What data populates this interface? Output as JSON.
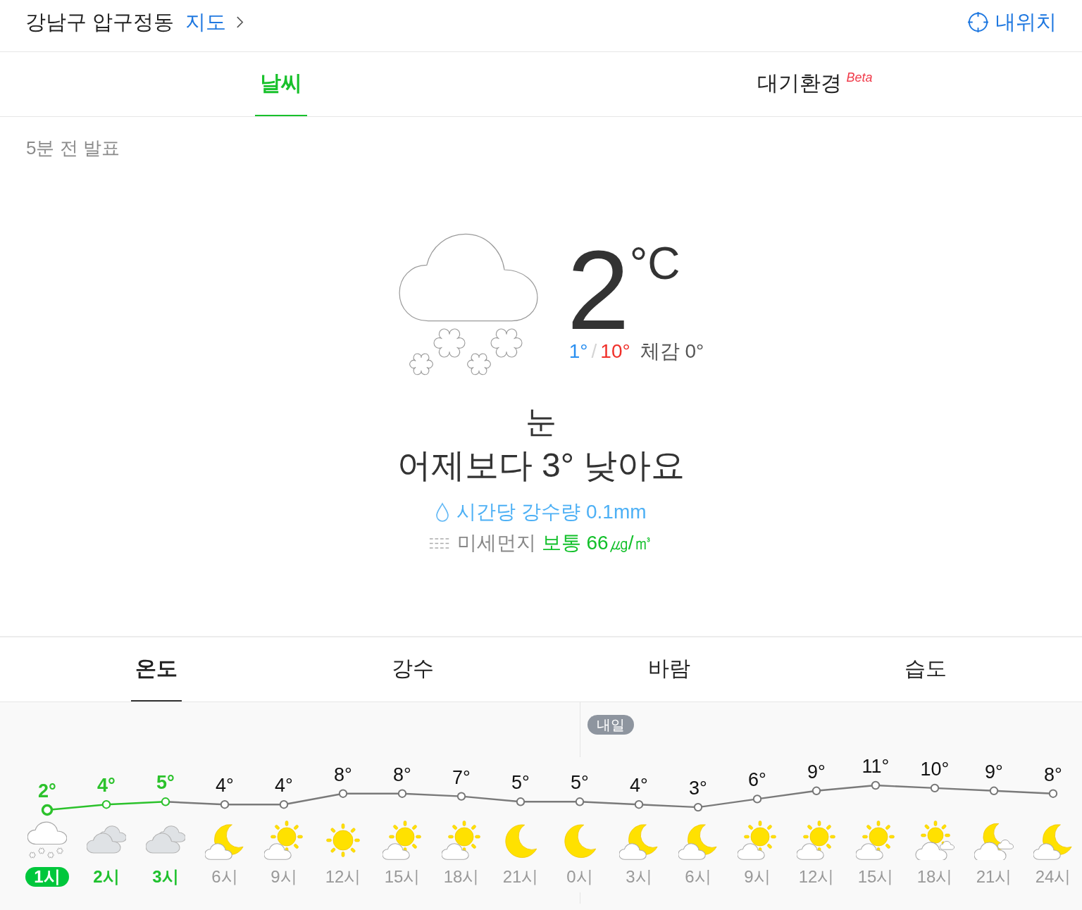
{
  "header": {
    "location": "강남구 압구정동",
    "map_link": "지도",
    "my_location": "내위치"
  },
  "tabs": [
    {
      "label": "날씨",
      "selected": true
    },
    {
      "label": "대기환경",
      "badge": "Beta",
      "selected": false
    }
  ],
  "current": {
    "updated": "5분 전 발표",
    "temperature": "2",
    "unit": "°C",
    "low": "1°",
    "separator": "/",
    "high": "10°",
    "feels_like": "체감 0°",
    "condition": "눈",
    "comparison": "어제보다 3° 낮아요",
    "precipitation": "시간당 강수량 0.1mm",
    "dust": {
      "label": "미세먼지",
      "grade": "보통",
      "value": "66㎍/㎥"
    }
  },
  "forecast_tabs": [
    {
      "label": "온도",
      "selected": true
    },
    {
      "label": "강수",
      "selected": false
    },
    {
      "label": "바람",
      "selected": false
    },
    {
      "label": "습도",
      "selected": false
    }
  ],
  "hourly": {
    "chart_data": {
      "type": "line",
      "marker": true,
      "categories": [
        "1시",
        "2시",
        "3시",
        "6시",
        "9시",
        "12시",
        "15시",
        "18시",
        "21시",
        "0시",
        "3시",
        "6시",
        "9시",
        "12시",
        "15시",
        "18시",
        "21시",
        "24시"
      ],
      "values": [
        2,
        4,
        5,
        4,
        4,
        8,
        8,
        7,
        5,
        5,
        4,
        3,
        6,
        9,
        11,
        10,
        9,
        8
      ],
      "value_labels": [
        "2°",
        "4°",
        "5°",
        "4°",
        "4°",
        "8°",
        "8°",
        "7°",
        "5°",
        "5°",
        "4°",
        "3°",
        "6°",
        "9°",
        "11°",
        "10°",
        "9°",
        "8°"
      ]
    },
    "items": [
      {
        "kind": "snow",
        "highlighted": true,
        "current": true
      },
      {
        "kind": "cloudy",
        "highlighted": true,
        "current": false
      },
      {
        "kind": "cloudy",
        "highlighted": true,
        "current": false
      },
      {
        "kind": "moon-cloud",
        "highlighted": false,
        "current": false
      },
      {
        "kind": "sun-cloud",
        "highlighted": false,
        "current": false
      },
      {
        "kind": "sun",
        "highlighted": false,
        "current": false
      },
      {
        "kind": "sun-cloud",
        "highlighted": false,
        "current": false
      },
      {
        "kind": "sun-cloud",
        "highlighted": false,
        "current": false
      },
      {
        "kind": "moon",
        "highlighted": false,
        "current": false
      },
      {
        "kind": "moon",
        "highlighted": false,
        "current": false,
        "day_label": "내일"
      },
      {
        "kind": "moon-cloud",
        "highlighted": false,
        "current": false
      },
      {
        "kind": "moon-cloud",
        "highlighted": false,
        "current": false
      },
      {
        "kind": "sun-cloud",
        "highlighted": false,
        "current": false
      },
      {
        "kind": "sun-cloud",
        "highlighted": false,
        "current": false
      },
      {
        "kind": "sun-cloud",
        "highlighted": false,
        "current": false
      },
      {
        "kind": "sun-clouds",
        "highlighted": false,
        "current": false
      },
      {
        "kind": "moon-clouds",
        "highlighted": false,
        "current": false
      },
      {
        "kind": "moon-cloud",
        "highlighted": false,
        "current": false
      }
    ]
  }
}
